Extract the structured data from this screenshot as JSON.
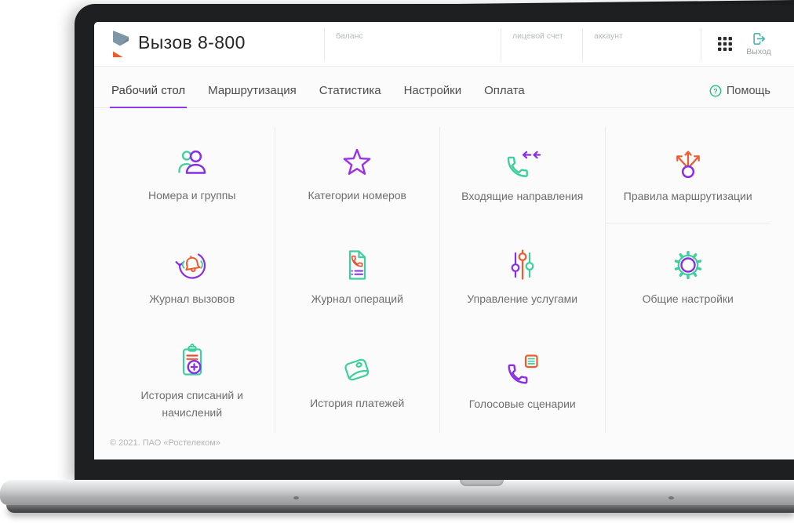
{
  "colors": {
    "purple": "#8A2EE6",
    "green": "#3FCF9F",
    "orange": "#EF5A2E",
    "red_orange": "#E2503C",
    "teal": "#4DB6AC",
    "tab_underline": "#8E3AE8",
    "logo_slate": "#7E96A5",
    "logo_orange": "#F05A28"
  },
  "header": {
    "logo_icon": "rostelecom-logo-icon",
    "title": "Вызов 8-800",
    "fields": [
      {
        "label": "баланс",
        "value": ""
      },
      {
        "label": "лицевой счет",
        "value": ""
      },
      {
        "label": "аккаунт",
        "value": ""
      }
    ],
    "apps_icon": "apps-grid-icon",
    "logout": {
      "icon": "logout-icon",
      "label": "Выход"
    }
  },
  "nav": {
    "tabs": [
      {
        "label": "Рабочий стол",
        "active": true
      },
      {
        "label": "Маршрутизация",
        "active": false
      },
      {
        "label": "Статистика",
        "active": false
      },
      {
        "label": "Настройки",
        "active": false
      },
      {
        "label": "Оплата",
        "active": false
      }
    ],
    "help": {
      "icon": "help-question-icon",
      "label": "Помощь"
    }
  },
  "tiles": [
    {
      "label": "Номера и группы",
      "icon": "users-icon"
    },
    {
      "label": "Категории номеров",
      "icon": "star-icon"
    },
    {
      "label": "Входящие направления",
      "icon": "incoming-call-icon"
    },
    {
      "label": "Правила маршрутизации",
      "icon": "routing-arrows-icon"
    },
    {
      "label": "Журнал вызовов",
      "icon": "call-log-icon"
    },
    {
      "label": "Журнал операций",
      "icon": "operations-log-icon"
    },
    {
      "label": "Управление услугами",
      "icon": "sliders-icon"
    },
    {
      "label": "Общие настройки",
      "icon": "gear-icon"
    },
    {
      "label": "История списаний и начислений",
      "icon": "clipboard-plus-icon"
    },
    {
      "label": "История платежей",
      "icon": "wallet-icon"
    },
    {
      "label": "Голосовые сценарии",
      "icon": "voice-script-icon"
    }
  ],
  "footer": {
    "copyright": "© 2021. ПАО «Ростелеком»"
  }
}
